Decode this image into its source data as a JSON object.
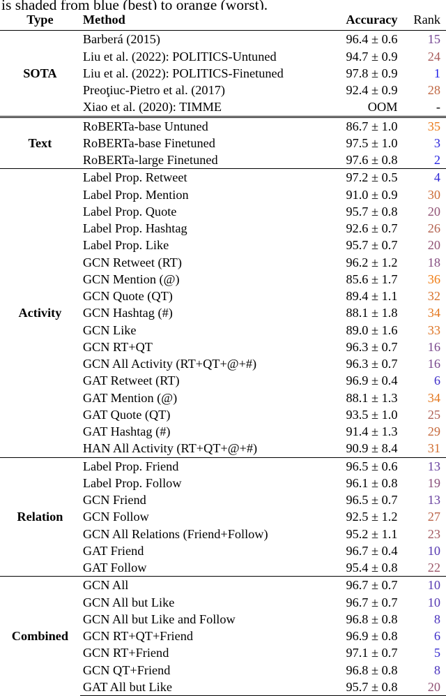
{
  "caption_tail": "is shaded from blue (best) to orange (worst).",
  "table": {
    "headers": {
      "type": "Type",
      "method": "Method",
      "accuracy": "Accuracy",
      "rank": "Rank"
    },
    "rank_color_scale": {
      "best_color": "#1f20e8",
      "worst_color": "#f07c12",
      "min_rank": 1,
      "max_rank": 36
    },
    "sections": [
      {
        "type": "SOTA",
        "rows": [
          {
            "method": "Barberá (2015)",
            "accuracy": "96.4 ± 0.6",
            "rank": "15",
            "rank_value": 15
          },
          {
            "method": "Liu et al. (2022): POLITICS-Untuned",
            "accuracy": "94.7 ± 0.9",
            "rank": "24",
            "rank_value": 24
          },
          {
            "method": "Liu et al. (2022): POLITICS-Finetuned",
            "accuracy": "97.8 ± 0.9",
            "rank": "1",
            "rank_value": 1
          },
          {
            "method": "Preoţiuc-Pietro et al. (2017)",
            "accuracy": "92.4 ± 0.9",
            "rank": "28",
            "rank_value": 28
          },
          {
            "method": "Xiao et al. (2020): TIMME",
            "accuracy": "OOM",
            "rank": "-",
            "rank_value": null
          }
        ]
      },
      {
        "type": "Text",
        "rows": [
          {
            "method": "RoBERTa-base Untuned",
            "accuracy": "86.7 ± 1.0",
            "rank": "35",
            "rank_value": 35
          },
          {
            "method": "RoBERTa-base Finetuned",
            "accuracy": "97.5 ± 1.0",
            "rank": "3",
            "rank_value": 3
          },
          {
            "method": "RoBERTa-large Finetuned",
            "accuracy": "97.6 ± 0.8",
            "rank": "2",
            "rank_value": 2
          }
        ]
      },
      {
        "type": "Activity",
        "rows": [
          {
            "method": "Label Prop. Retweet",
            "accuracy": "97.2 ± 0.5",
            "rank": "4",
            "rank_value": 4
          },
          {
            "method": "Label Prop. Mention",
            "accuracy": "91.0 ± 0.9",
            "rank": "30",
            "rank_value": 30
          },
          {
            "method": "Label Prop. Quote",
            "accuracy": "95.7 ± 0.8",
            "rank": "20",
            "rank_value": 20
          },
          {
            "method": "Label Prop. Hashtag",
            "accuracy": "92.6 ± 0.7",
            "rank": "26",
            "rank_value": 26
          },
          {
            "method": "Label Prop. Like",
            "accuracy": "95.7 ± 0.7",
            "rank": "20",
            "rank_value": 20
          },
          {
            "method": "GCN Retweet (RT)",
            "accuracy": "96.2 ± 1.2",
            "rank": "18",
            "rank_value": 18
          },
          {
            "method": "GCN Mention (@)",
            "accuracy": "85.6 ± 1.7",
            "rank": "36",
            "rank_value": 36
          },
          {
            "method": "GCN Quote (QT)",
            "accuracy": "89.4 ± 1.1",
            "rank": "32",
            "rank_value": 32
          },
          {
            "method": "GCN Hashtag (#)",
            "accuracy": "88.1 ± 1.8",
            "rank": "34",
            "rank_value": 34
          },
          {
            "method": "GCN Like",
            "accuracy": "89.0 ± 1.6",
            "rank": "33",
            "rank_value": 33
          },
          {
            "method": "GCN RT+QT",
            "accuracy": "96.3 ± 0.7",
            "rank": "16",
            "rank_value": 16
          },
          {
            "method": "GCN All Activity (RT+QT+@+#)",
            "accuracy": "96.3 ± 0.7",
            "rank": "16",
            "rank_value": 16
          },
          {
            "method": "GAT Retweet (RT)",
            "accuracy": "96.9 ± 0.4",
            "rank": "6",
            "rank_value": 6
          },
          {
            "method": "GAT Mention (@)",
            "accuracy": "88.1 ± 1.3",
            "rank": "34",
            "rank_value": 34
          },
          {
            "method": "GAT Quote (QT)",
            "accuracy": "93.5 ± 1.0",
            "rank": "25",
            "rank_value": 25
          },
          {
            "method": "GAT Hashtag (#)",
            "accuracy": "91.4 ± 1.3",
            "rank": "29",
            "rank_value": 29
          },
          {
            "method": "HAN All Activity (RT+QT+@+#)",
            "accuracy": "90.9 ± 8.4",
            "rank": "31",
            "rank_value": 31
          }
        ]
      },
      {
        "type": "Relation",
        "rows": [
          {
            "method": "Label Prop. Friend",
            "accuracy": "96.5 ± 0.6",
            "rank": "13",
            "rank_value": 13
          },
          {
            "method": "Label Prop. Follow",
            "accuracy": "96.1 ± 0.8",
            "rank": "19",
            "rank_value": 19
          },
          {
            "method": "GCN Friend",
            "accuracy": "96.5 ± 0.7",
            "rank": "13",
            "rank_value": 13
          },
          {
            "method": "GCN Follow",
            "accuracy": "92.5 ± 1.2",
            "rank": "27",
            "rank_value": 27
          },
          {
            "method": "GCN All Relations (Friend+Follow)",
            "accuracy": "95.2 ± 1.1",
            "rank": "23",
            "rank_value": 23
          },
          {
            "method": "GAT Friend",
            "accuracy": "96.7 ± 0.4",
            "rank": "10",
            "rank_value": 10
          },
          {
            "method": "GAT Follow",
            "accuracy": "95.4 ± 0.8",
            "rank": "22",
            "rank_value": 22
          }
        ]
      },
      {
        "type": "Combined",
        "rows": [
          {
            "method": "GCN All",
            "accuracy": "96.7 ± 0.7",
            "rank": "10",
            "rank_value": 10
          },
          {
            "method": "GCN All but Like",
            "accuracy": "96.7 ± 0.7",
            "rank": "10",
            "rank_value": 10
          },
          {
            "method": "GCN All but Like and Follow",
            "accuracy": "96.8 ± 0.8",
            "rank": "8",
            "rank_value": 8
          },
          {
            "method": "GCN RT+QT+Friend",
            "accuracy": "96.9 ± 0.8",
            "rank": "6",
            "rank_value": 6
          },
          {
            "method": "GCN RT+Friend",
            "accuracy": "97.1 ± 0.7",
            "rank": "5",
            "rank_value": 5
          },
          {
            "method": "GCN QT+Friend",
            "accuracy": "96.8 ± 0.8",
            "rank": "8",
            "rank_value": 8
          },
          {
            "method": "GAT All but Like",
            "accuracy": "95.7 ± 0.8",
            "rank": "20",
            "rank_value": 20
          }
        ]
      }
    ]
  }
}
